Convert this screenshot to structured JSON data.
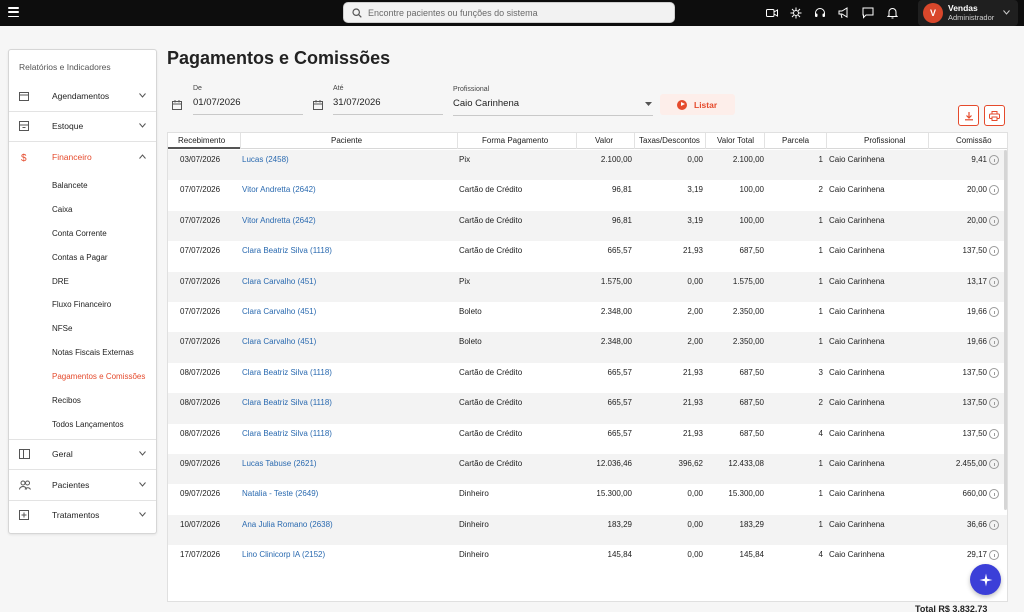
{
  "topbar": {
    "search_placeholder": "Encontre pacientes ou funções do sistema",
    "icons": [
      "video-icon",
      "bug-icon",
      "headset-icon",
      "announcement-icon",
      "chat-icon",
      "bell-icon"
    ],
    "user": {
      "initial": "V",
      "name": "Vendas",
      "role": "Administrador"
    }
  },
  "sidebar": {
    "title": "Relatórios e Indicadores",
    "groups": {
      "agendamentos": "Agendamentos",
      "estoque": "Estoque",
      "financeiro": "Financeiro",
      "geral": "Geral",
      "pacientes": "Pacientes",
      "tratamentos": "Tratamentos"
    },
    "financeiro_items": [
      "Balancete",
      "Caixa",
      "Conta Corrente",
      "Contas a Pagar",
      "DRE",
      "Fluxo Financeiro",
      "NFSe",
      "Notas Fiscais Externas",
      "Pagamentos e Comissões",
      "Recibos",
      "Todos Lançamentos"
    ],
    "active_item": "Pagamentos e Comissões",
    "accent": "#e54a2c"
  },
  "page": {
    "title": "Pagamentos e Comissões"
  },
  "filters": {
    "de_label": "De",
    "de_value": "01/07/2026",
    "ate_label": "Até",
    "ate_value": "31/07/2026",
    "profissional_label": "Profissional",
    "profissional_value": "Caio Carinhena",
    "listar_label": "Listar"
  },
  "table": {
    "columns": [
      "Recebimento",
      "Paciente",
      "Forma Pagamento",
      "Valor",
      "Taxas/Descontos",
      "Valor Total",
      "Parcela",
      "Profissional",
      "Comissão"
    ],
    "rows": [
      [
        "03/07/2026",
        "Lucas (2458)",
        "Pix",
        "2.100,00",
        "0,00",
        "2.100,00",
        "1",
        "Caio Carinhena",
        "9,41"
      ],
      [
        "07/07/2026",
        "Vitor Andretta (2642)",
        "Cartão de Crédito",
        "96,81",
        "3,19",
        "100,00",
        "2",
        "Caio Carinhena",
        "20,00"
      ],
      [
        "07/07/2026",
        "Vitor Andretta (2642)",
        "Cartão de Crédito",
        "96,81",
        "3,19",
        "100,00",
        "1",
        "Caio Carinhena",
        "20,00"
      ],
      [
        "07/07/2026",
        "Clara Beatriz Silva (1118)",
        "Cartão de Crédito",
        "665,57",
        "21,93",
        "687,50",
        "1",
        "Caio Carinhena",
        "137,50"
      ],
      [
        "07/07/2026",
        "Clara Carvalho (451)",
        "Pix",
        "1.575,00",
        "0,00",
        "1.575,00",
        "1",
        "Caio Carinhena",
        "13,17"
      ],
      [
        "07/07/2026",
        "Clara Carvalho (451)",
        "Boleto",
        "2.348,00",
        "2,00",
        "2.350,00",
        "1",
        "Caio Carinhena",
        "19,66"
      ],
      [
        "07/07/2026",
        "Clara Carvalho (451)",
        "Boleto",
        "2.348,00",
        "2,00",
        "2.350,00",
        "1",
        "Caio Carinhena",
        "19,66"
      ],
      [
        "08/07/2026",
        "Clara Beatriz Silva (1118)",
        "Cartão de Crédito",
        "665,57",
        "21,93",
        "687,50",
        "3",
        "Caio Carinhena",
        "137,50"
      ],
      [
        "08/07/2026",
        "Clara Beatriz Silva (1118)",
        "Cartão de Crédito",
        "665,57",
        "21,93",
        "687,50",
        "2",
        "Caio Carinhena",
        "137,50"
      ],
      [
        "08/07/2026",
        "Clara Beatriz Silva (1118)",
        "Cartão de Crédito",
        "665,57",
        "21,93",
        "687,50",
        "4",
        "Caio Carinhena",
        "137,50"
      ],
      [
        "09/07/2026",
        "Lucas Tabuse (2621)",
        "Cartão de Crédito",
        "12.036,46",
        "396,62",
        "12.433,08",
        "1",
        "Caio Carinhena",
        "2.455,00"
      ],
      [
        "09/07/2026",
        "Natalia - Teste (2649)",
        "Dinheiro",
        "15.300,00",
        "0,00",
        "15.300,00",
        "1",
        "Caio Carinhena",
        "660,00"
      ],
      [
        "10/07/2026",
        "Ana Julia Romano (2638)",
        "Dinheiro",
        "183,29",
        "0,00",
        "183,29",
        "1",
        "Caio Carinhena",
        "36,66"
      ],
      [
        "17/07/2026",
        "Lino Clinicorp IA (2152)",
        "Dinheiro",
        "145,84",
        "0,00",
        "145,84",
        "4",
        "Caio Carinhena",
        "29,17"
      ]
    ]
  },
  "footer": {
    "total": "Total R$ 3.832,73"
  }
}
